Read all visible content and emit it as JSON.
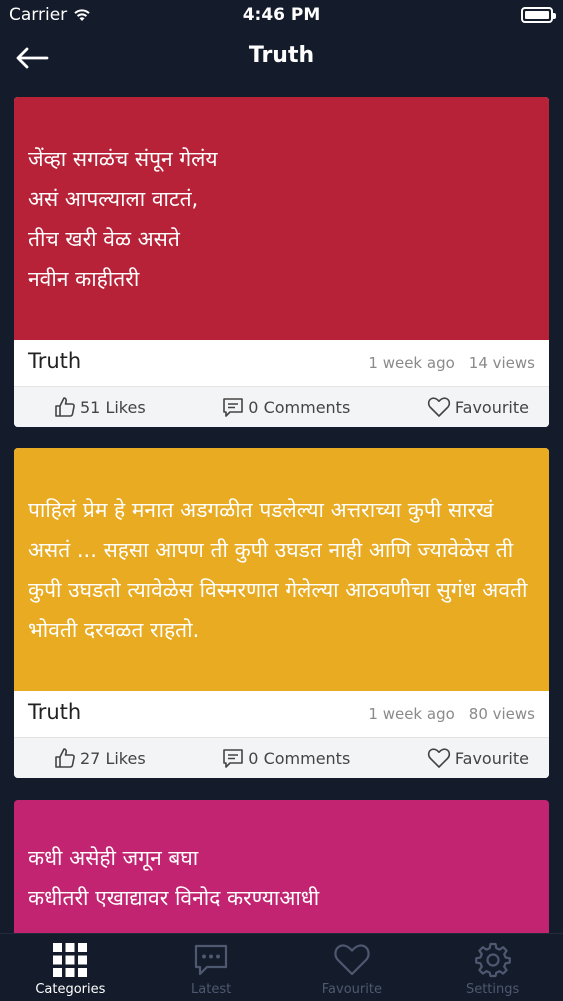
{
  "status": {
    "carrier": "Carrier",
    "time": "4:46 PM"
  },
  "header": {
    "title": "Truth"
  },
  "cards": [
    {
      "text": "जेंव्हा सगळंच संपून गेलंय\nअसं आपल्याला वाटतं,\nतीच खरी वेळ असते\nनवीन काहीतरी",
      "category": "Truth",
      "time_ago": "1 week ago",
      "views": "14 views",
      "likes": "51 Likes",
      "comments": "0 Comments",
      "favourite": "Favourite",
      "color": "#b82238"
    },
    {
      "text": "पाहिलं प्रेम हे मनात अडगळीत पडलेल्या अत्तराच्या कुपी सारखं असतं ... सहसा आपण ती कुपी उघडत नाही आणि ज्यावेळेस ती कुपी उघडतो त्यावेळेस विस्मरणात गेलेल्या आठवणीचा सुगंध अवती भोवती दरवळत राहतो.",
      "category": "Truth",
      "time_ago": "1 week ago",
      "views": "80 views",
      "likes": "27 Likes",
      "comments": "0 Comments",
      "favourite": "Favourite",
      "color": "#e8ab22"
    },
    {
      "text": "कधी असेही जगून बघा\nकधीतरी एखाद्यावर विनोद करण्याआधी",
      "color": "#c32471"
    }
  ],
  "tabs": [
    {
      "label": "Categories",
      "icon": "grid-icon"
    },
    {
      "label": "Latest",
      "icon": "chat-bubble-icon"
    },
    {
      "label": "Favourite",
      "icon": "heart-icon"
    },
    {
      "label": "Settings",
      "icon": "gear-icon"
    }
  ],
  "colors": {
    "background": "#141b2a",
    "active_tab": "#ffffff",
    "inactive_tab": "#4e5870"
  }
}
